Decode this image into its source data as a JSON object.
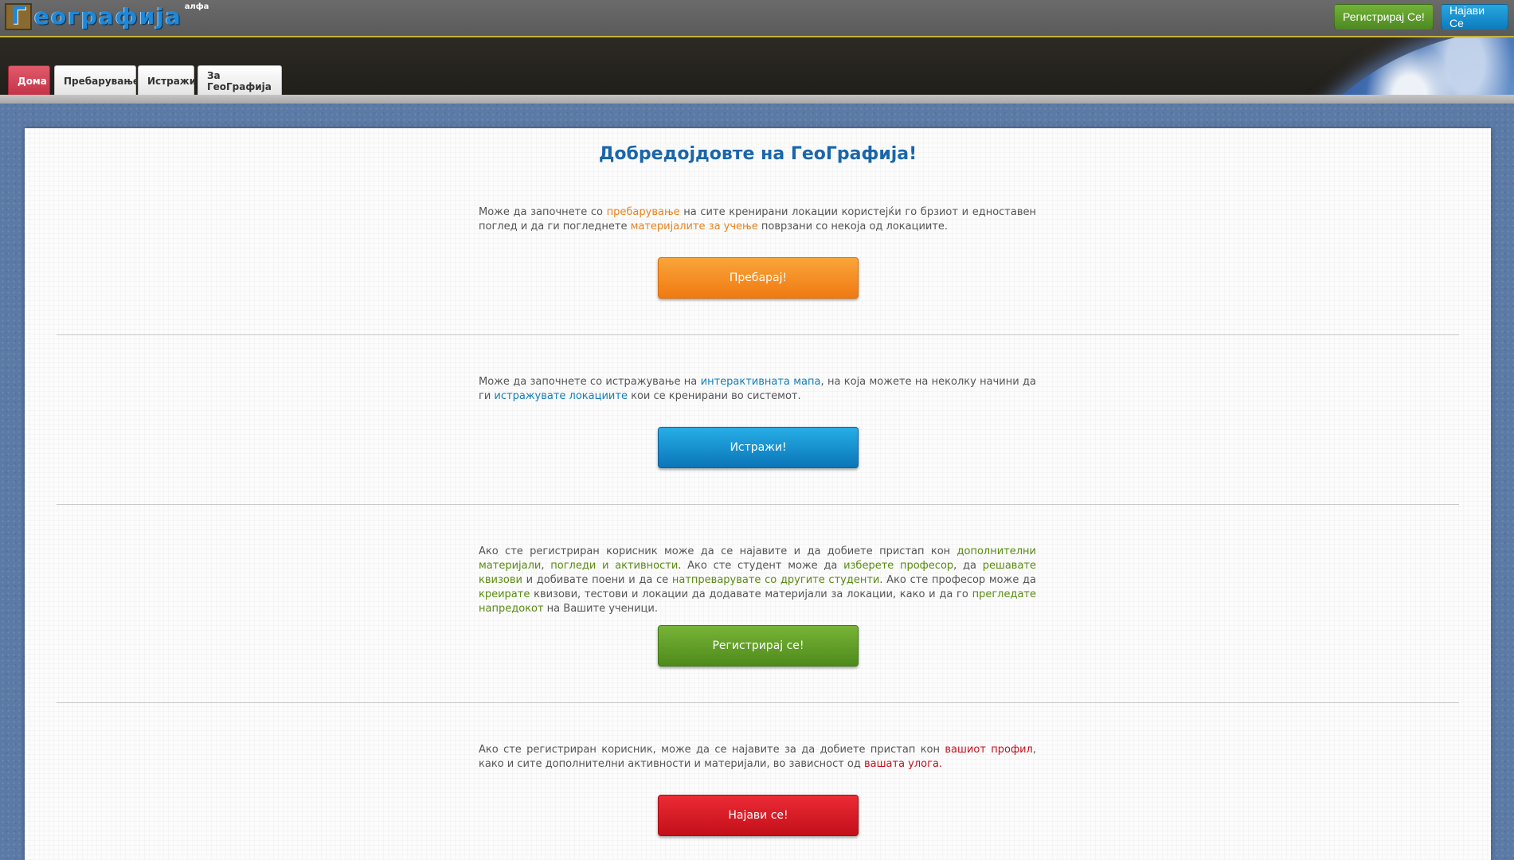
{
  "header": {
    "logo_letter": "Г",
    "logo_text": "еографија",
    "logo_sup": "алфа",
    "register_label": "Регистрирај Се!",
    "login_label": "Најави Се"
  },
  "nav": {
    "tabs": [
      {
        "label": "Дома",
        "active": true
      },
      {
        "label": "Пребарување",
        "active": false
      },
      {
        "label": "Истражи",
        "active": false
      },
      {
        "label": "За ГеоГрафија",
        "active": false
      }
    ]
  },
  "main": {
    "title": "Добредојдовте на ГеоГрафија!",
    "section_search": {
      "t1": "Може да започнете со ",
      "l1": "пребарување",
      "t2": " на сите кренирани локации користејќи го брзиот и едноставен поглед и да ги погледнете ",
      "l2": "материјалите за учење",
      "t3": " поврзани со некоја од локациите.",
      "button": "Пребарај!"
    },
    "section_explore": {
      "t1": "Може да започнете со истражување на ",
      "l1": "интерактивната мапа",
      "t2": ", на која можете на неколку начини да ги ",
      "l2": "истражувате локациите",
      "t3": " кои се кренирани во системот.",
      "button": "Истражи!"
    },
    "section_register": {
      "t1": "Ако сте регистриран корисник може да се најавите и да добиете пристап кон ",
      "l1": "дополнителни материјали",
      "t2": ", ",
      "l2": "погледи и активности",
      "t3": ". Ако сте студент може да ",
      "l3": "изберете професор",
      "t4": ", да ",
      "l4": "решавате квизови",
      "t5": " и добивате поени и да се ",
      "l5": "натпреварувате со другите студенти",
      "t6": ". Ако сте професор може да ",
      "l6": "креирате",
      "t7": " квизови, тестови и локации да додавате материјали за локации, како и да го ",
      "l7": "прегледате напредокот",
      "t8": " на Вашите ученици.",
      "button": "Регистрирај се!"
    },
    "section_login": {
      "t1": "Ако сте регистриран корисник, може да се најавите за да добиете пристап кон ",
      "l1": "вашиот профил",
      "t2": ", како и сите дополнителни активности и материјали, во зависност од ",
      "l2": "вашата улога.",
      "button": "Најави се!"
    }
  },
  "colors": {
    "accent_orange": "#f07a12",
    "accent_blue": "#0a75b8",
    "accent_green": "#4d8a1c",
    "accent_red": "#c20f1a",
    "title_blue": "#1a66aa"
  }
}
